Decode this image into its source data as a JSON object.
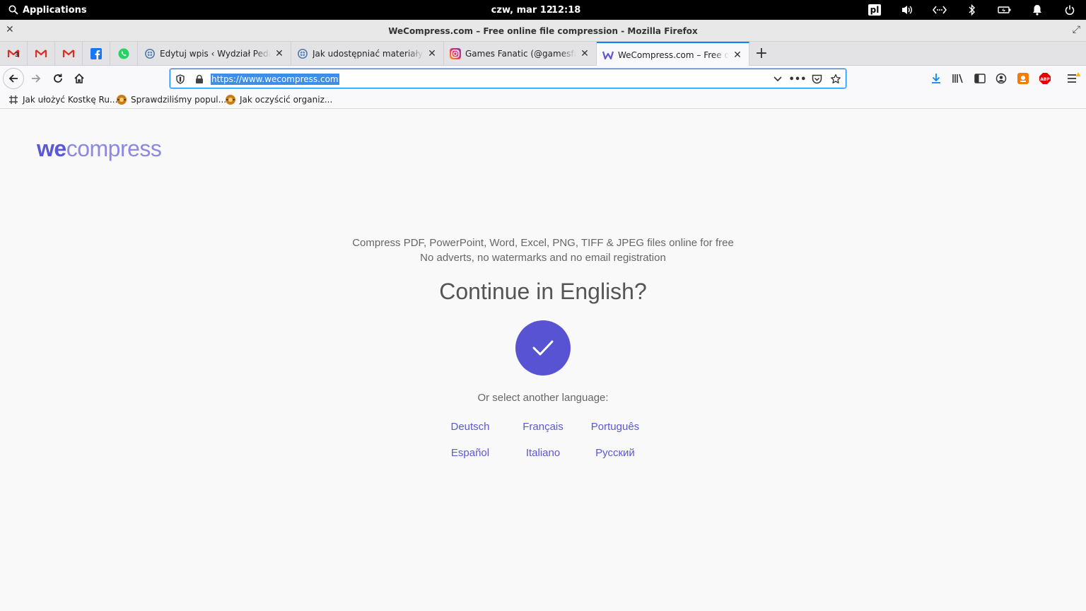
{
  "system": {
    "apps_label": "Applications",
    "date": "czw, mar 12",
    "time": "12:18",
    "keyboard_layout": "pl"
  },
  "window": {
    "title": "WeCompress.com – Free online file compression - Mozilla Firefox"
  },
  "tabs": [
    {
      "label": "Edytuj wpis ‹ Wydział Pedagogiczny"
    },
    {
      "label": "Jak udostępniać materiały dla"
    },
    {
      "label": "Games Fanatic (@gamesfanatic)"
    },
    {
      "label": "WeCompress.com – Free online file"
    }
  ],
  "pinned_tabs": [
    "gmail-icon",
    "gmail-icon",
    "gmail-icon",
    "facebook-icon",
    "whatsapp-icon"
  ],
  "gmail_badge": "3",
  "url": "https://www.wecompress.com",
  "bookmarks": [
    {
      "label": "Jak ułożyć Kostkę Ru..."
    },
    {
      "label": "Sprawdziliśmy popul..."
    },
    {
      "label": "Jak oczyścić organiz..."
    }
  ],
  "page": {
    "logo_we": "we",
    "logo_compress": "compress",
    "tagline1": "Compress PDF, PowerPoint, Word, Excel, PNG, TIFF & JPEG files online for free",
    "tagline2": "No adverts, no watermarks and no email registration",
    "heading": "Continue in English?",
    "or_select": "Or select another language:",
    "languages": [
      "Deutsch",
      "Français",
      "Português",
      "Español",
      "Italiano",
      "Русский"
    ]
  },
  "colors": {
    "brand": "#5b58d6",
    "brand_light": "#8c89e2",
    "accent_focus": "#0a84ff"
  }
}
